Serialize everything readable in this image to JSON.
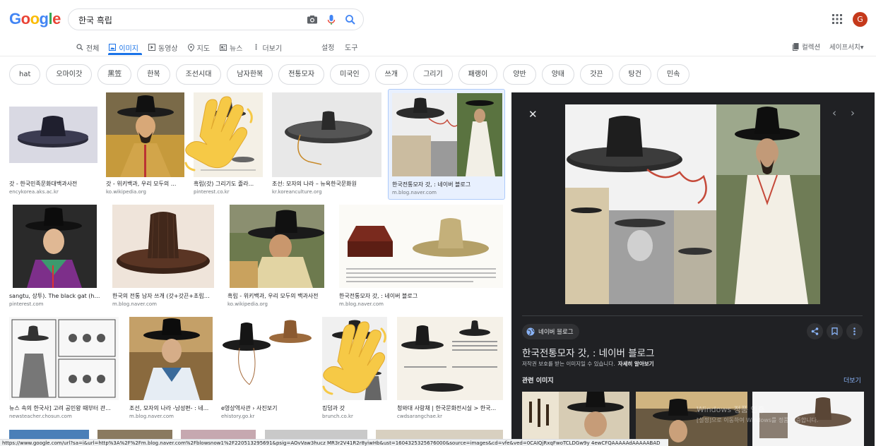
{
  "logo": "Google",
  "search": {
    "query": "한국 흑립"
  },
  "account": {
    "initial": "G"
  },
  "tabs": [
    {
      "label": "전체",
      "icon": "search-icon"
    },
    {
      "label": "이미지",
      "icon": "image-icon",
      "active": true
    },
    {
      "label": "동영상",
      "icon": "video-icon"
    },
    {
      "label": "지도",
      "icon": "map-pin-icon"
    },
    {
      "label": "뉴스",
      "icon": "news-icon"
    },
    {
      "label": "더보기",
      "icon": "more-vert-icon"
    }
  ],
  "settings_label": "설정",
  "tools_label": "도구",
  "collections_label": "컬렉션",
  "safesearch_label": "세이프서치▾",
  "chips": [
    "hat",
    "오마이갓",
    "黑笠",
    "한복",
    "조선시대",
    "남자한복",
    "전통모자",
    "미국인",
    "쓰개",
    "그리기",
    "패랭이",
    "양반",
    "양태",
    "갓끈",
    "탕건",
    "민속"
  ],
  "results": [
    {
      "caption": "갓 - 한국민족문화대백과사전",
      "domain": "encykorea.aks.ac.kr"
    },
    {
      "caption": "갓 - 위키백과, 우리 모두의 ...",
      "domain": "ko.wikipedia.org"
    },
    {
      "caption": "흑립(갓) 그리기도 졸라...",
      "domain": "pinterest.co.kr"
    },
    {
      "caption": "조선: 모자의 나라 – 뉴욕한국문화원",
      "domain": "kr.koreanculture.org"
    },
    {
      "caption": "한국전통모자 갓, : 네이버 블로그",
      "domain": "m.blog.naver.com"
    },
    {
      "caption": "sangtu, 상투). The black gat (heu...",
      "domain": "pinterest.com"
    },
    {
      "caption": "한국의 전통 남자 쓰개 (갓+갓끈+초립+...",
      "domain": "m.blog.naver.com"
    },
    {
      "caption": "흑립 - 위키백과, 우리 모두의 백과사전",
      "domain": "ko.wikipedia.org"
    },
    {
      "caption": "한국전통모자 갓, : 네이버 블로그",
      "domain": "m.blog.naver.com"
    },
    {
      "caption": "뉴스 속의 한국사] 고려 공민왕 때부터 관...",
      "domain": "newsteacher.chosun.com"
    },
    {
      "caption": "조선, 모자의 나라 -남성편- : 네...",
      "domain": "m.blog.naver.com"
    },
    {
      "caption": "e영상역사관 › 사진보기",
      "domain": "ehistory.go.kr"
    },
    {
      "caption": "킹덤과 갓",
      "domain": "brunch.co.kr"
    },
    {
      "caption": "청와대 사랑채 | 한국문화전시실 > 한국...",
      "domain": "cwdsarangchae.kr"
    }
  ],
  "panel": {
    "source": "네이버 블로그",
    "title": "한국전통모자 갓, : 네이버 블로그",
    "copyright": "저작권 보호를 받는 이미지일 수 있습니다.",
    "learn_more": "자세히 알아보기",
    "related": "관련 이미지",
    "more": "더보기",
    "watermark_1": "Windows 정품 인증",
    "watermark_2": "[설정]으로 이동하여 Windows를 정품 인증합니다."
  },
  "status_url": "https://www.google.com/url?sa=i&url=http%3A%2F%2Fm.blog.naver.com%2Fblowsnow1%2F220513295691&psig=AOvVaw3hucz MR3r2V41R2r8yiwHb&ust=1604325325676000&source=images&cd=vfe&ved=0CAIQjRxqFwoTCLDGw9y 4ewCFQAAAAAdAAAAABAD",
  "colors": {
    "accent": "#1a73e8",
    "panel_bg": "#202124",
    "avatar": "#c5391b"
  }
}
